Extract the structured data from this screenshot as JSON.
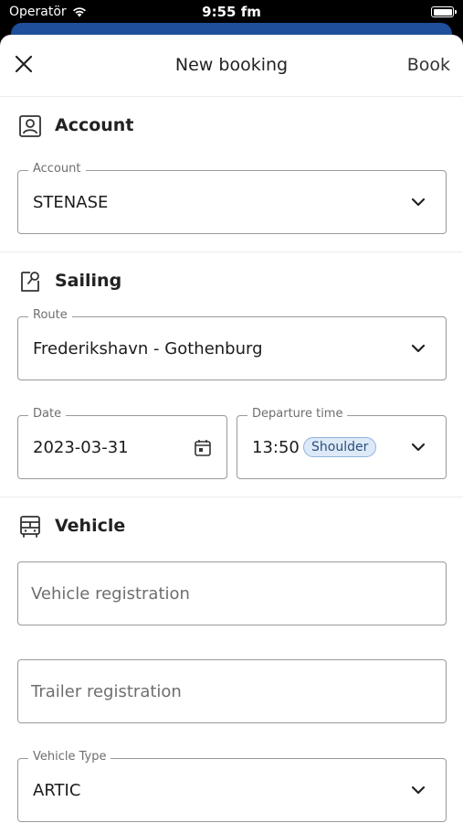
{
  "status_bar": {
    "carrier": "Operatör",
    "time": "9:55 fm"
  },
  "nav": {
    "title": "New booking",
    "book_label": "Book"
  },
  "account_section": {
    "title": "Account",
    "account_field": {
      "label": "Account",
      "value": "STENASE"
    }
  },
  "sailing_section": {
    "title": "Sailing",
    "route_field": {
      "label": "Route",
      "value": "Frederikshavn - Gothenburg"
    },
    "date_field": {
      "label": "Date",
      "value": "2023-03-31"
    },
    "departure_field": {
      "label": "Departure time",
      "value": "13:50",
      "badge": "Shoulder"
    }
  },
  "vehicle_section": {
    "title": "Vehicle",
    "vehicle_registration": {
      "placeholder": "Vehicle registration"
    },
    "trailer_registration": {
      "placeholder": "Trailer registration"
    },
    "vehicle_type_field": {
      "label": "Vehicle Type",
      "value": "ARTIC"
    }
  },
  "colors": {
    "accent_peek": "#1f4f9b",
    "badge_bg": "#dde9f7",
    "badge_border": "#8fb3dd"
  }
}
